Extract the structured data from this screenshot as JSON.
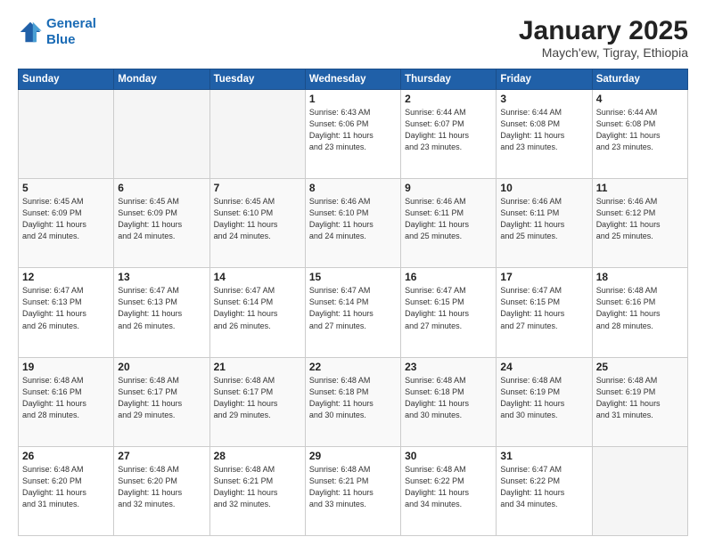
{
  "header": {
    "logo_line1": "General",
    "logo_line2": "Blue",
    "month": "January 2025",
    "location": "Maych'ew, Tigray, Ethiopia"
  },
  "days_of_week": [
    "Sunday",
    "Monday",
    "Tuesday",
    "Wednesday",
    "Thursday",
    "Friday",
    "Saturday"
  ],
  "weeks": [
    [
      {
        "day": "",
        "info": ""
      },
      {
        "day": "",
        "info": ""
      },
      {
        "day": "",
        "info": ""
      },
      {
        "day": "1",
        "info": "Sunrise: 6:43 AM\nSunset: 6:06 PM\nDaylight: 11 hours\nand 23 minutes."
      },
      {
        "day": "2",
        "info": "Sunrise: 6:44 AM\nSunset: 6:07 PM\nDaylight: 11 hours\nand 23 minutes."
      },
      {
        "day": "3",
        "info": "Sunrise: 6:44 AM\nSunset: 6:08 PM\nDaylight: 11 hours\nand 23 minutes."
      },
      {
        "day": "4",
        "info": "Sunrise: 6:44 AM\nSunset: 6:08 PM\nDaylight: 11 hours\nand 23 minutes."
      }
    ],
    [
      {
        "day": "5",
        "info": "Sunrise: 6:45 AM\nSunset: 6:09 PM\nDaylight: 11 hours\nand 24 minutes."
      },
      {
        "day": "6",
        "info": "Sunrise: 6:45 AM\nSunset: 6:09 PM\nDaylight: 11 hours\nand 24 minutes."
      },
      {
        "day": "7",
        "info": "Sunrise: 6:45 AM\nSunset: 6:10 PM\nDaylight: 11 hours\nand 24 minutes."
      },
      {
        "day": "8",
        "info": "Sunrise: 6:46 AM\nSunset: 6:10 PM\nDaylight: 11 hours\nand 24 minutes."
      },
      {
        "day": "9",
        "info": "Sunrise: 6:46 AM\nSunset: 6:11 PM\nDaylight: 11 hours\nand 25 minutes."
      },
      {
        "day": "10",
        "info": "Sunrise: 6:46 AM\nSunset: 6:11 PM\nDaylight: 11 hours\nand 25 minutes."
      },
      {
        "day": "11",
        "info": "Sunrise: 6:46 AM\nSunset: 6:12 PM\nDaylight: 11 hours\nand 25 minutes."
      }
    ],
    [
      {
        "day": "12",
        "info": "Sunrise: 6:47 AM\nSunset: 6:13 PM\nDaylight: 11 hours\nand 26 minutes."
      },
      {
        "day": "13",
        "info": "Sunrise: 6:47 AM\nSunset: 6:13 PM\nDaylight: 11 hours\nand 26 minutes."
      },
      {
        "day": "14",
        "info": "Sunrise: 6:47 AM\nSunset: 6:14 PM\nDaylight: 11 hours\nand 26 minutes."
      },
      {
        "day": "15",
        "info": "Sunrise: 6:47 AM\nSunset: 6:14 PM\nDaylight: 11 hours\nand 27 minutes."
      },
      {
        "day": "16",
        "info": "Sunrise: 6:47 AM\nSunset: 6:15 PM\nDaylight: 11 hours\nand 27 minutes."
      },
      {
        "day": "17",
        "info": "Sunrise: 6:47 AM\nSunset: 6:15 PM\nDaylight: 11 hours\nand 27 minutes."
      },
      {
        "day": "18",
        "info": "Sunrise: 6:48 AM\nSunset: 6:16 PM\nDaylight: 11 hours\nand 28 minutes."
      }
    ],
    [
      {
        "day": "19",
        "info": "Sunrise: 6:48 AM\nSunset: 6:16 PM\nDaylight: 11 hours\nand 28 minutes."
      },
      {
        "day": "20",
        "info": "Sunrise: 6:48 AM\nSunset: 6:17 PM\nDaylight: 11 hours\nand 29 minutes."
      },
      {
        "day": "21",
        "info": "Sunrise: 6:48 AM\nSunset: 6:17 PM\nDaylight: 11 hours\nand 29 minutes."
      },
      {
        "day": "22",
        "info": "Sunrise: 6:48 AM\nSunset: 6:18 PM\nDaylight: 11 hours\nand 30 minutes."
      },
      {
        "day": "23",
        "info": "Sunrise: 6:48 AM\nSunset: 6:18 PM\nDaylight: 11 hours\nand 30 minutes."
      },
      {
        "day": "24",
        "info": "Sunrise: 6:48 AM\nSunset: 6:19 PM\nDaylight: 11 hours\nand 30 minutes."
      },
      {
        "day": "25",
        "info": "Sunrise: 6:48 AM\nSunset: 6:19 PM\nDaylight: 11 hours\nand 31 minutes."
      }
    ],
    [
      {
        "day": "26",
        "info": "Sunrise: 6:48 AM\nSunset: 6:20 PM\nDaylight: 11 hours\nand 31 minutes."
      },
      {
        "day": "27",
        "info": "Sunrise: 6:48 AM\nSunset: 6:20 PM\nDaylight: 11 hours\nand 32 minutes."
      },
      {
        "day": "28",
        "info": "Sunrise: 6:48 AM\nSunset: 6:21 PM\nDaylight: 11 hours\nand 32 minutes."
      },
      {
        "day": "29",
        "info": "Sunrise: 6:48 AM\nSunset: 6:21 PM\nDaylight: 11 hours\nand 33 minutes."
      },
      {
        "day": "30",
        "info": "Sunrise: 6:48 AM\nSunset: 6:22 PM\nDaylight: 11 hours\nand 34 minutes."
      },
      {
        "day": "31",
        "info": "Sunrise: 6:47 AM\nSunset: 6:22 PM\nDaylight: 11 hours\nand 34 minutes."
      },
      {
        "day": "",
        "info": ""
      }
    ]
  ]
}
